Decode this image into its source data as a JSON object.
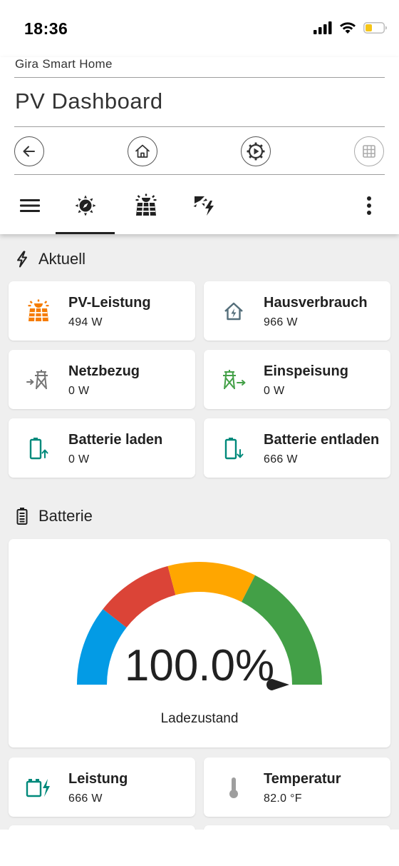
{
  "status": {
    "time": "18:36"
  },
  "header": {
    "app_name": "Gira Smart Home",
    "title": "PV Dashboard"
  },
  "sections": {
    "aktuell": "Aktuell",
    "batterie": "Batterie"
  },
  "aktuell_cards": [
    {
      "name": "PV-Leistung",
      "value": "494 W",
      "icon": "solar-panel-icon",
      "color": "#f57c00"
    },
    {
      "name": "Hausverbrauch",
      "value": "966 W",
      "icon": "home-lightning-icon",
      "color": "#546e7a"
    },
    {
      "name": "Netzbezug",
      "value": "0 W",
      "icon": "transmission-tower-import-icon",
      "color": "#757575"
    },
    {
      "name": "Einspeisung",
      "value": "0 W",
      "icon": "transmission-tower-export-icon",
      "color": "#43a047"
    },
    {
      "name": "Batterie laden",
      "value": "0 W",
      "icon": "battery-charging-up-icon",
      "color": "#00897b"
    },
    {
      "name": "Batterie entladen",
      "value": "666 W",
      "icon": "battery-charging-down-icon",
      "color": "#00897b"
    }
  ],
  "gauge": {
    "value_text": "100.0%",
    "value": 100,
    "label": "Ladezustand",
    "colors": [
      "#039be5",
      "#db4437",
      "#ffa600",
      "#43a047"
    ]
  },
  "batterie_cards": [
    {
      "name": "Leistung",
      "value": "666 W",
      "icon": "battery-charging-icon",
      "color": "#00897b"
    },
    {
      "name": "Temperatur",
      "value": "82.0 °F",
      "icon": "thermometer-icon",
      "color": "#9e9e9e"
    }
  ]
}
